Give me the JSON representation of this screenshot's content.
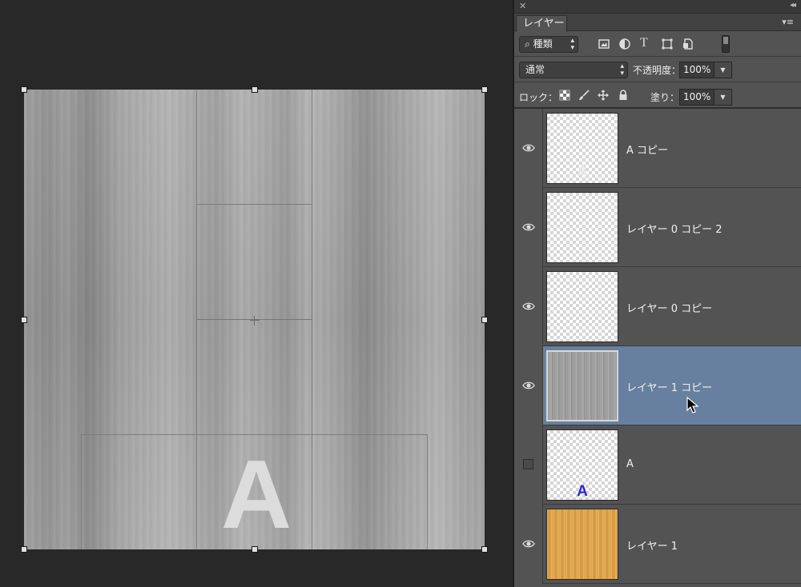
{
  "panel": {
    "close_glyph": "✕",
    "collapse_glyph": "◂◂",
    "tab_label": "レイヤー",
    "menu_glyph": "▾≡"
  },
  "filter": {
    "search_glyph": "⌕",
    "kind_label": "種類",
    "icons": [
      "image-filter-icon",
      "adjustment-filter-icon",
      "type-filter-icon",
      "shape-filter-icon",
      "smart-object-filter-icon"
    ],
    "type_glyph": "T"
  },
  "blend": {
    "mode": "通常",
    "opacity_label": "不透明度：",
    "opacity_value": "100%"
  },
  "lock": {
    "label": "ロック：",
    "icons": [
      "lock-transparent-pixels-icon",
      "lock-image-pixels-icon",
      "lock-position-icon",
      "lock-all-icon"
    ],
    "fill_label": "塗り：",
    "fill_value": "100%"
  },
  "canvas": {
    "letter": "A",
    "letter_color": "#dcdcdc"
  },
  "colors": {
    "panel_bg": "#535353",
    "selected_row": "#67809f",
    "workspace_bg": "#282828",
    "thumb_letter_blue": "#2a2ad8"
  },
  "layers": [
    {
      "name": "A コピー",
      "visible": true,
      "selected": false,
      "thumbnail": "transparent"
    },
    {
      "name": "レイヤー 0 コピー 2",
      "visible": true,
      "selected": false,
      "thumbnail": "transparent"
    },
    {
      "name": "レイヤー 0 コピー",
      "visible": true,
      "selected": false,
      "thumbnail": "transparent"
    },
    {
      "name": "レイヤー 1 コピー",
      "visible": true,
      "selected": true,
      "thumbnail": "gray-wood"
    },
    {
      "name": "A",
      "visible": false,
      "selected": false,
      "thumbnail": "transparent-with-blue-A",
      "thumb_letter": "A"
    },
    {
      "name": "レイヤー 1",
      "visible": true,
      "selected": false,
      "thumbnail": "wood"
    }
  ]
}
